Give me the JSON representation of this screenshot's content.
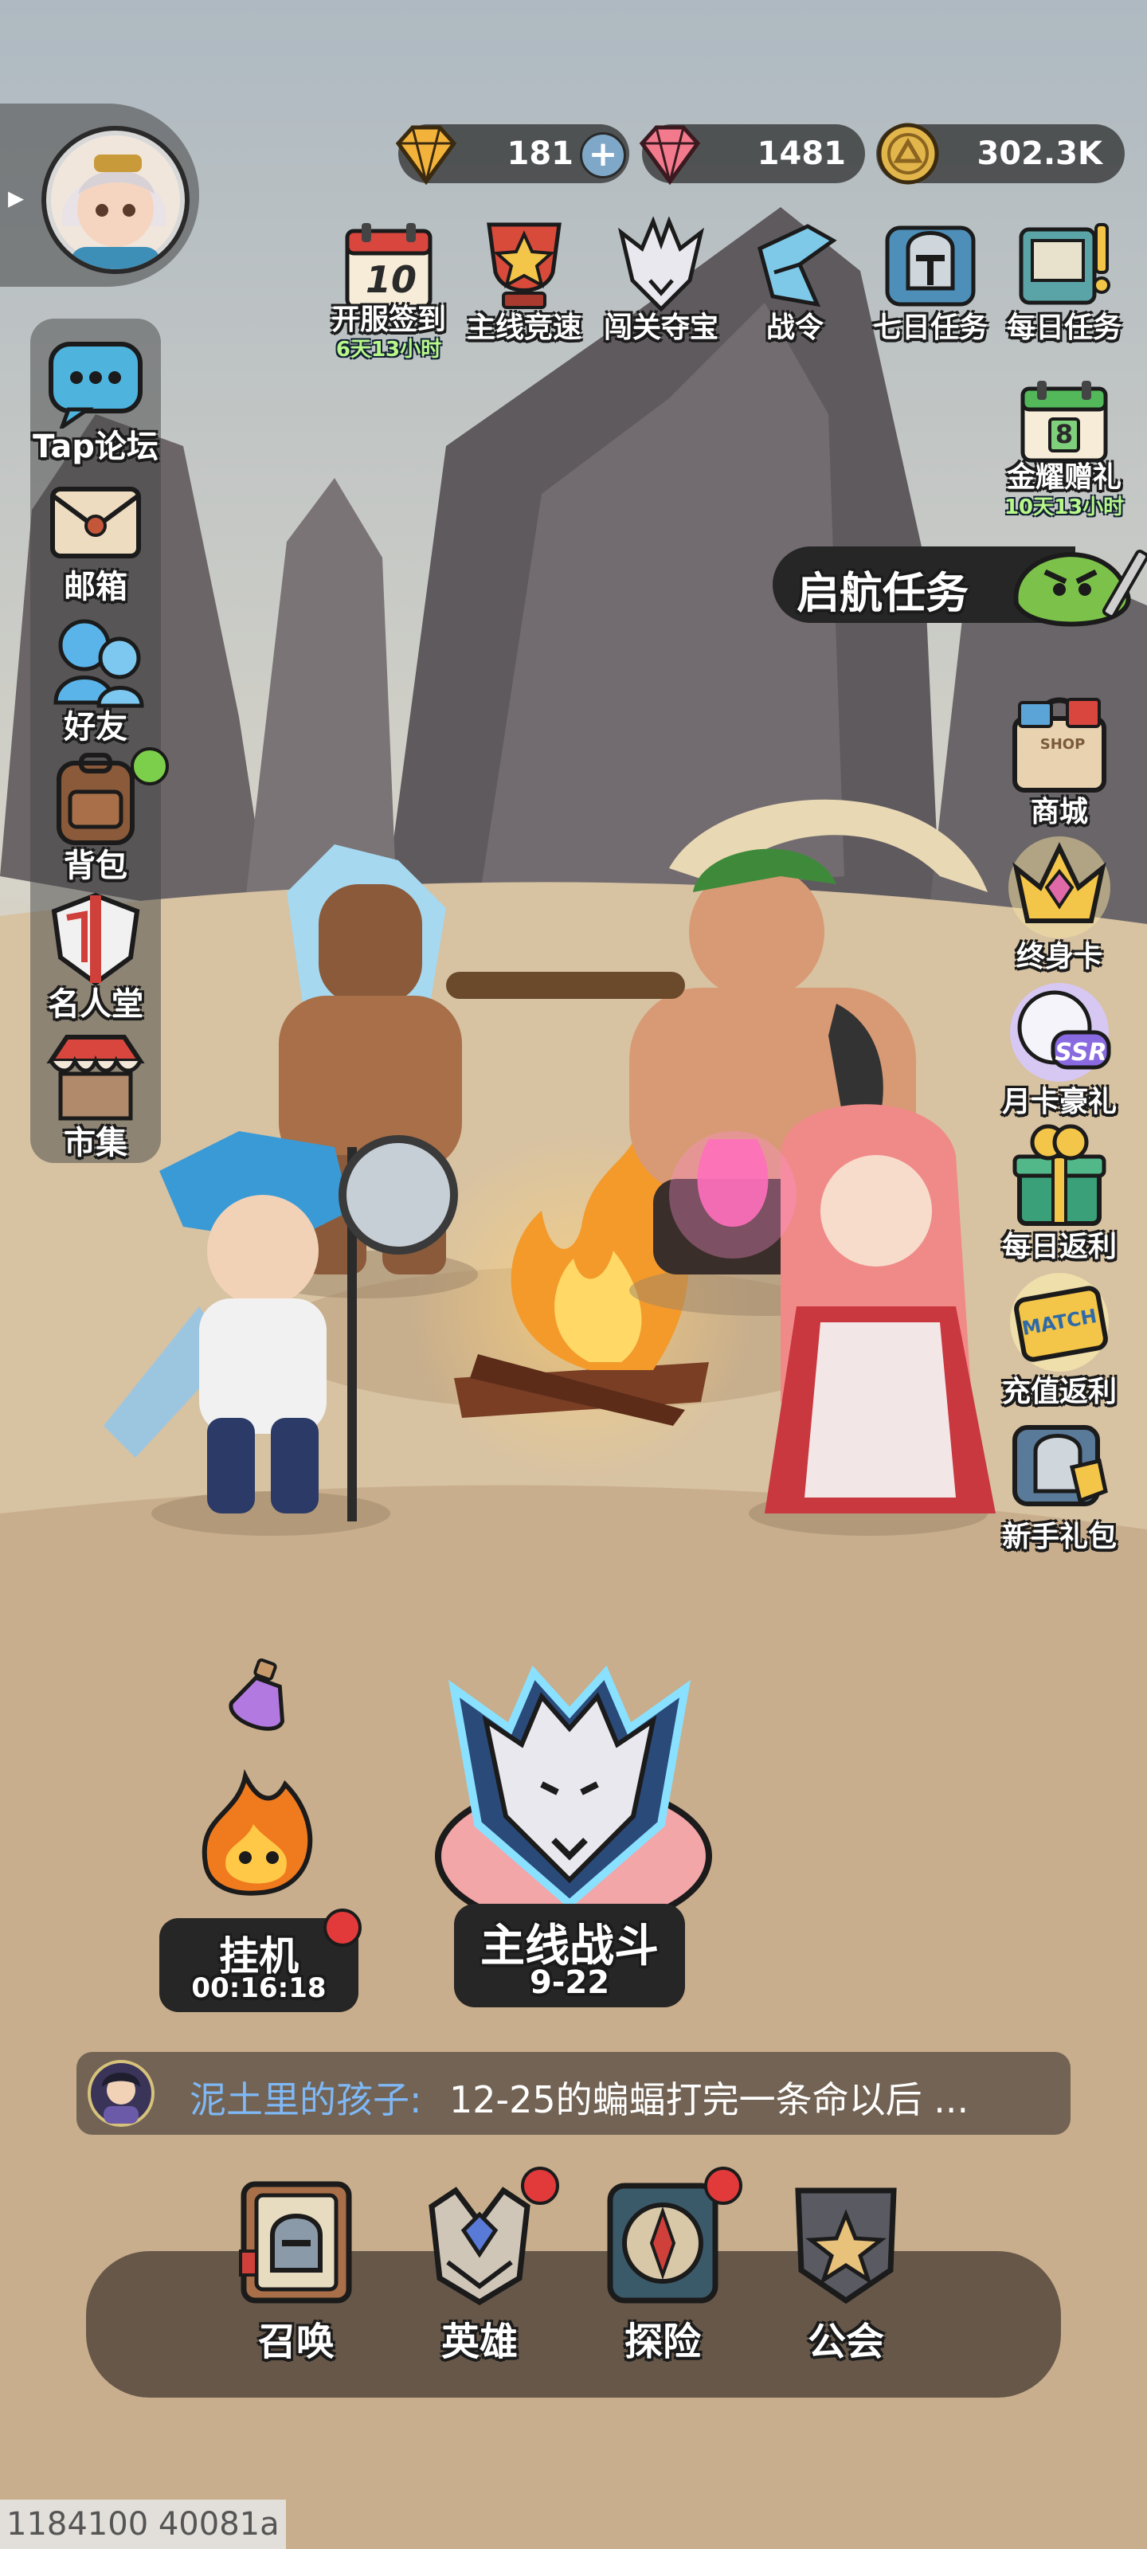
{
  "resources": {
    "diamonds": "181",
    "gems": "1481",
    "gold": "302.3K"
  },
  "top_menu": [
    {
      "label": "开服签到",
      "sub": "6天13小时",
      "calendar_number": "10"
    },
    {
      "label": "主线竞速"
    },
    {
      "label": "闯关夺宝"
    },
    {
      "label": "战令"
    },
    {
      "label": "七日任务"
    },
    {
      "label": "每日任务"
    }
  ],
  "golden_gift": {
    "label": "金耀赠礼",
    "sub": "10天13小时",
    "calendar_number": "8"
  },
  "voyage_task": {
    "label": "启航任务"
  },
  "left_menu": [
    {
      "label": "Tap论坛"
    },
    {
      "label": "邮箱"
    },
    {
      "label": "好友"
    },
    {
      "label": "背包"
    },
    {
      "label": "名人堂"
    },
    {
      "label": "市集"
    }
  ],
  "right_menu": [
    {
      "label": "商城",
      "icon_text": "SHOP"
    },
    {
      "label": "终身卡"
    },
    {
      "label": "月卡豪礼",
      "icon_text": "SSR"
    },
    {
      "label": "每日返利"
    },
    {
      "label": "充值返利",
      "icon_text": "MATCH"
    },
    {
      "label": "新手礼包"
    }
  ],
  "idle": {
    "label": "挂机",
    "time": "00:16:18"
  },
  "main_battle": {
    "label": "主线战斗",
    "stage": "9-22"
  },
  "chat": {
    "name": "泥土里的孩子:",
    "message": "12-25的蝙蝠打完一条命以后 ..."
  },
  "bottom_nav": [
    {
      "label": "召唤"
    },
    {
      "label": "英雄"
    },
    {
      "label": "探险"
    },
    {
      "label": "公会"
    }
  ],
  "footer_id": "1184100 40081a",
  "colors": {
    "sky_top": "#b8c4cc",
    "ground": "#d9c6a8",
    "notification_red": "#e23a3a",
    "chat_name_blue": "#7fb8f5",
    "timer_green": "#b9f78a"
  }
}
